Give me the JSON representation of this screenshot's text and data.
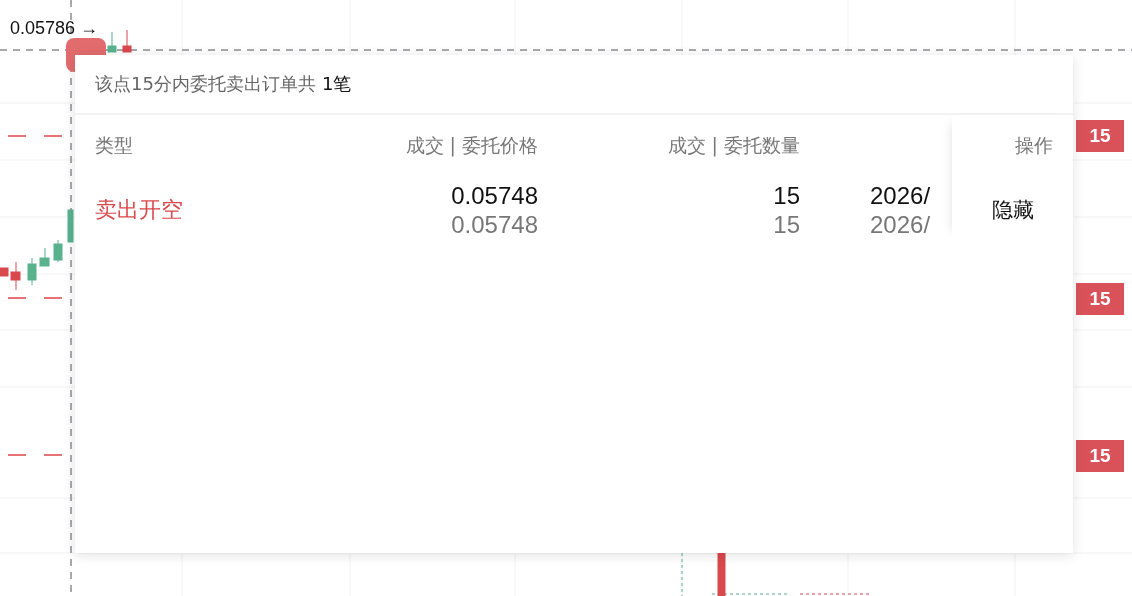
{
  "price_label": "0.05786 →",
  "order_tags": [
    {
      "label": "15"
    },
    {
      "label": "15"
    },
    {
      "label": "15"
    }
  ],
  "popup": {
    "title": "该点15分内委托卖出订单共",
    "count": "1笔",
    "columns": [
      "类型",
      "成交 | 委托价格",
      "成交 | 委托数量",
      "操作"
    ],
    "rows": [
      {
        "kind": "sell",
        "type": "卖出开空",
        "price_filled": "0.05748",
        "price_order": "0.05748",
        "qty_filled": "15",
        "qty_order": "15",
        "time_filled": "2026/",
        "time_order": "2026/",
        "action": "隐藏"
      }
    ]
  }
}
